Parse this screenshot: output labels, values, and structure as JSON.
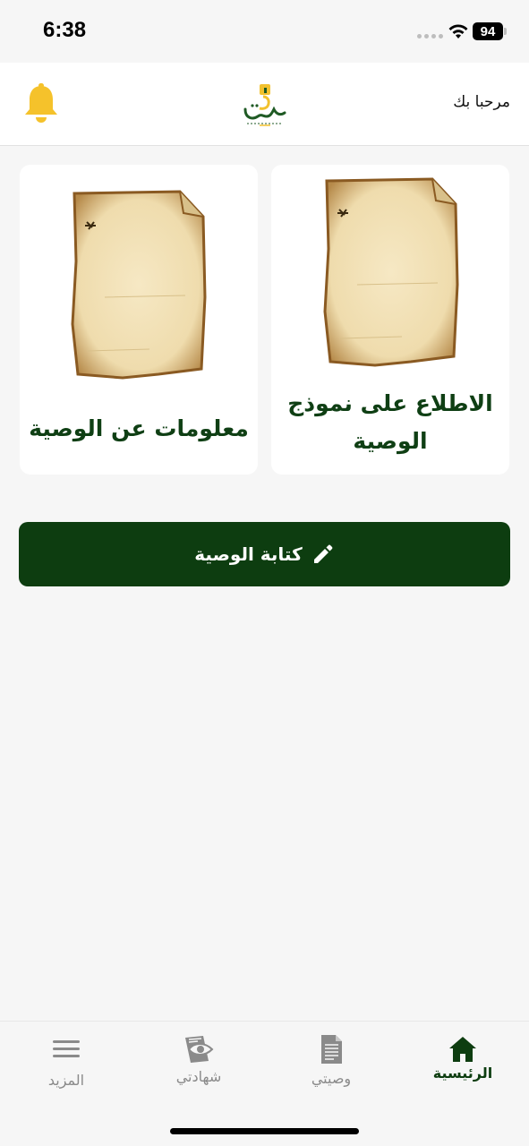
{
  "status_bar": {
    "time": "6:38",
    "battery": "94"
  },
  "header": {
    "welcome": "مرحبا بك",
    "notification_icon": "bell-icon",
    "logo_icon": "app-logo"
  },
  "cards": [
    {
      "title": "الاطلاع على نموذج الوصية",
      "image": "parchment-scroll"
    },
    {
      "title": "معلومات عن الوصية",
      "image": "parchment-scroll"
    }
  ],
  "write_button": {
    "label": "كتابة الوصية",
    "icon": "pencil-icon"
  },
  "tab_bar": {
    "items": [
      {
        "label": "الرئيسية",
        "icon": "home-icon",
        "active": true
      },
      {
        "label": "وصيتي",
        "icon": "document-icon",
        "active": false
      },
      {
        "label": "شهادتي",
        "icon": "eye-certificate-icon",
        "active": false
      },
      {
        "label": "المزيد",
        "icon": "menu-icon",
        "active": false
      }
    ]
  },
  "colors": {
    "primary": "#0d3d10",
    "card_title": "#0f3f14",
    "bell": "#f5c22b",
    "background": "#f6f6f6",
    "inactive_tab": "#8a8a8a"
  }
}
